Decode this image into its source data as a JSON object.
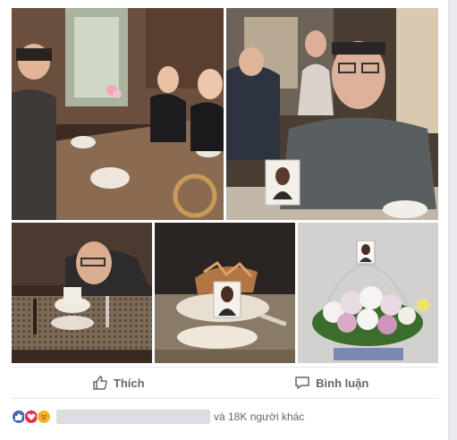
{
  "actions": {
    "like_label": "Thích",
    "comment_label": "Bình luận"
  },
  "reactions": {
    "others_text": "và 18K người khác",
    "icons": [
      "like-icon",
      "love-icon",
      "sad-icon"
    ],
    "colors": {
      "like": "#4267b2",
      "love": "#f0284a",
      "sad": "#f7b125"
    }
  }
}
